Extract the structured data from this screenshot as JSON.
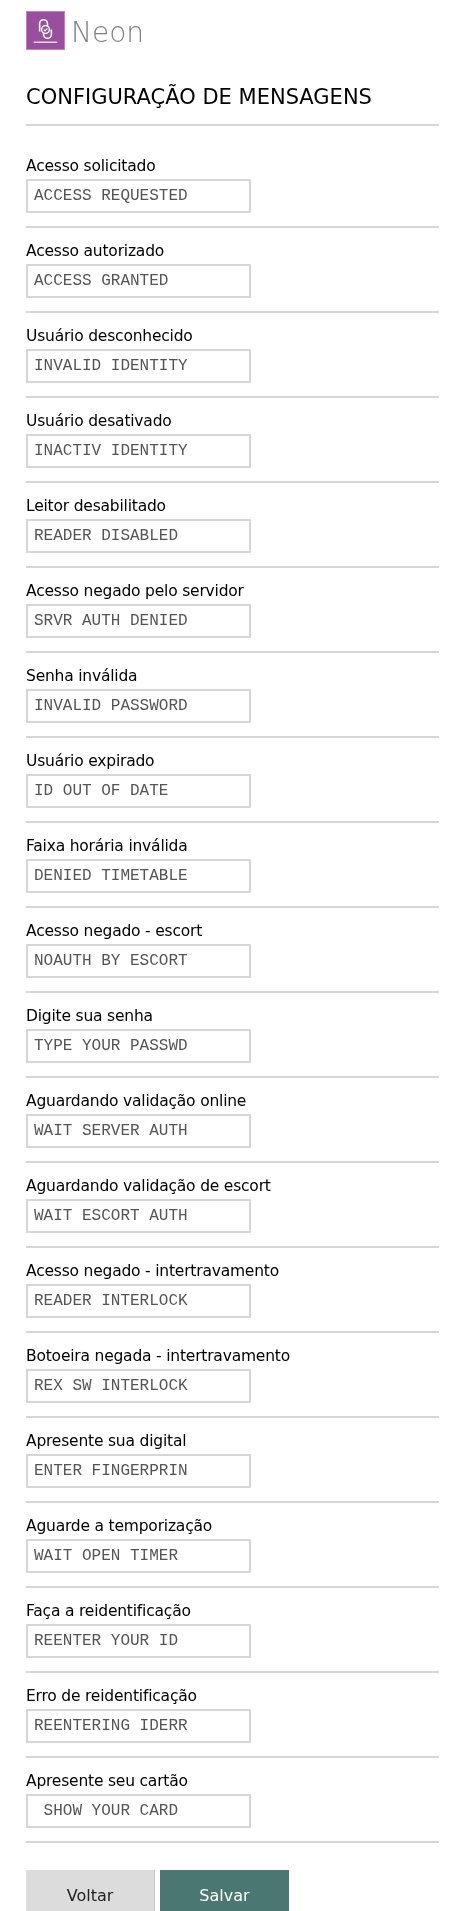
{
  "logo": {
    "text": "Neon"
  },
  "title": "CONFIGURAÇÃO DE MENSAGENS",
  "messages": [
    {
      "label": "Acesso solicitado",
      "value": "ACCESS REQUESTED"
    },
    {
      "label": "Acesso autorizado",
      "value": "ACCESS GRANTED"
    },
    {
      "label": "Usuário desconhecido",
      "value": "INVALID IDENTITY"
    },
    {
      "label": "Usuário desativado",
      "value": "INACTIV IDENTITY"
    },
    {
      "label": "Leitor desabilitado",
      "value": "READER DISABLED"
    },
    {
      "label": "Acesso negado pelo servidor",
      "value": "SRVR AUTH DENIED"
    },
    {
      "label": "Senha inválida",
      "value": "INVALID PASSWORD"
    },
    {
      "label": "Usuário expirado",
      "value": "ID OUT OF DATE"
    },
    {
      "label": "Faixa horária inválida",
      "value": "DENIED TIMETABLE"
    },
    {
      "label": "Acesso negado - escort",
      "value": "NOAUTH BY ESCORT"
    },
    {
      "label": "Digite sua senha",
      "value": "TYPE YOUR PASSWD"
    },
    {
      "label": "Aguardando validação online",
      "value": "WAIT SERVER AUTH"
    },
    {
      "label": "Aguardando validação de escort",
      "value": "WAIT ESCORT AUTH"
    },
    {
      "label": "Acesso negado - intertravamento",
      "value": "READER INTERLOCK"
    },
    {
      "label": "Botoeira negada - intertravamento",
      "value": "REX SW INTERLOCK"
    },
    {
      "label": "Apresente sua digital",
      "value": "ENTER FINGERPRIN"
    },
    {
      "label": "Aguarde a temporização",
      "value": "WAIT OPEN TIMER"
    },
    {
      "label": "Faça a reidentificação",
      "value": "REENTER YOUR ID"
    },
    {
      "label": "Erro de reidentificação",
      "value": "REENTERING IDERR"
    },
    {
      "label": "Apresente seu cartão",
      "value": " SHOW YOUR CARD"
    }
  ],
  "buttons": [
    {
      "label": "Voltar",
      "kind": "secondary"
    },
    {
      "label": "Salvar",
      "kind": "primary"
    }
  ]
}
